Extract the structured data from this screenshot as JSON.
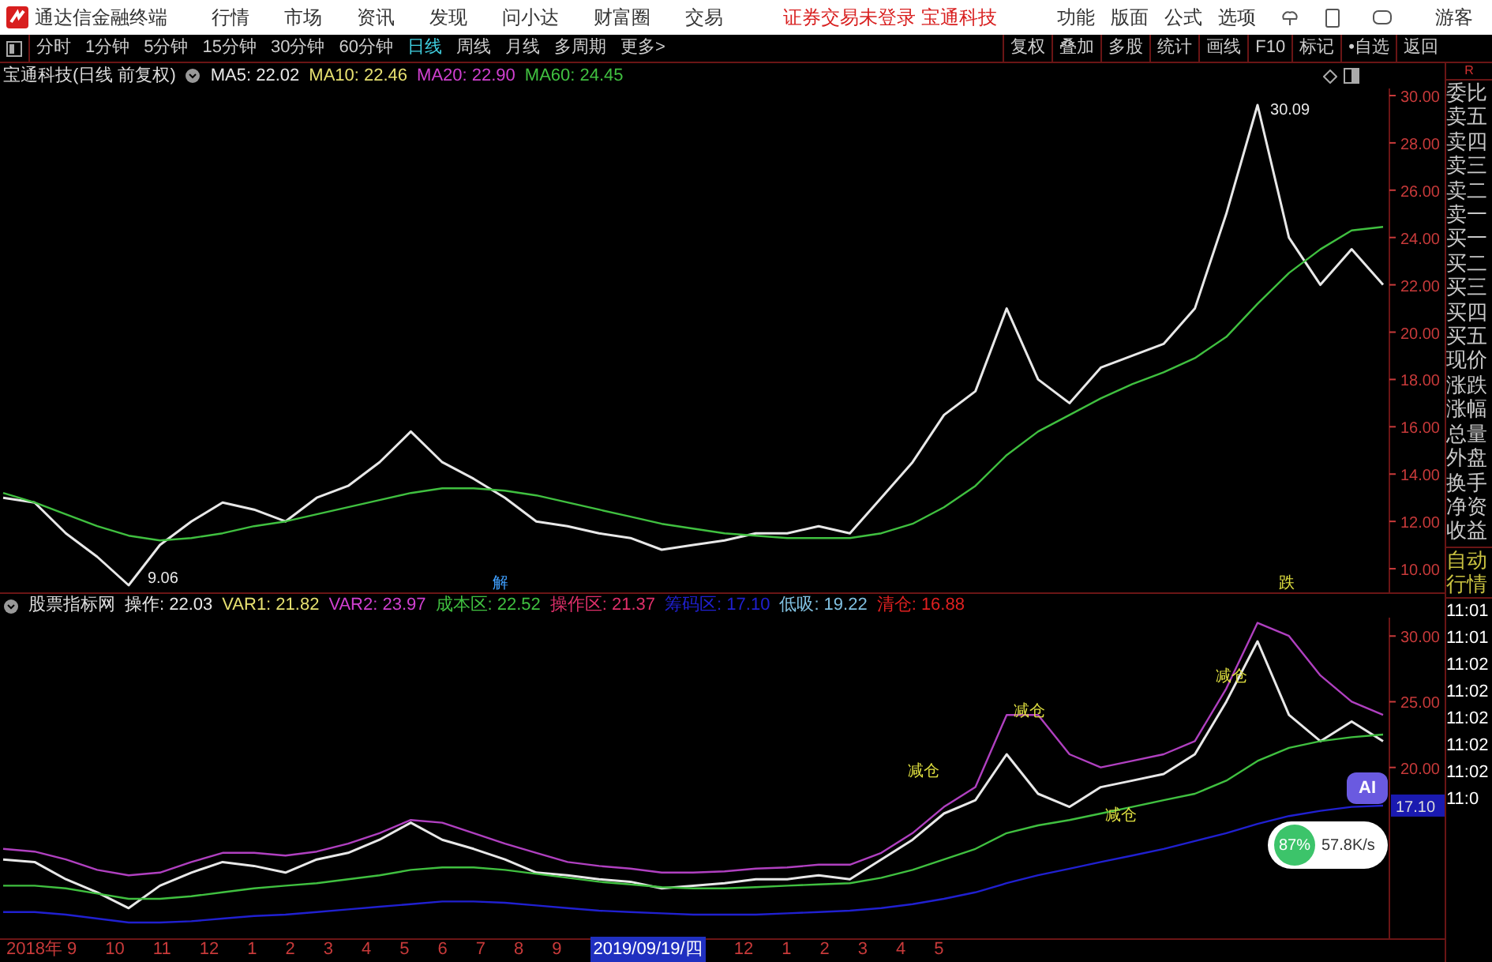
{
  "title_bar": {
    "app_name": "通达信金融终端",
    "menus": [
      "行情",
      "市场",
      "资讯",
      "发现",
      "问小达",
      "财富圈",
      "交易"
    ],
    "login_notice": "证券交易未登录 宝通科技",
    "tools": [
      "功能",
      "版面",
      "公式",
      "选项"
    ],
    "user": "游客"
  },
  "toolbar": {
    "periods": [
      {
        "label": "分时",
        "selected": false
      },
      {
        "label": "1分钟",
        "selected": false
      },
      {
        "label": "5分钟",
        "selected": false
      },
      {
        "label": "15分钟",
        "selected": false
      },
      {
        "label": "30分钟",
        "selected": false
      },
      {
        "label": "60分钟",
        "selected": false
      },
      {
        "label": "日线",
        "selected": true
      },
      {
        "label": "周线",
        "selected": false
      },
      {
        "label": "月线",
        "selected": false
      },
      {
        "label": "多周期",
        "selected": false
      },
      {
        "label": "更多>",
        "selected": false
      }
    ],
    "actions": [
      "复权",
      "叠加",
      "多股",
      "统计",
      "画线",
      "F10",
      "标记",
      "•自选",
      "返回"
    ]
  },
  "price_chart": {
    "title": "宝通科技(日线 前复权)",
    "indicators": [
      {
        "label": "MA5: 22.02",
        "color": "#e8e8e8"
      },
      {
        "label": "MA10: 22.46",
        "color": "#e6e070"
      },
      {
        "label": "MA20: 22.90",
        "color": "#d040d0"
      },
      {
        "label": "MA60: 24.45",
        "color": "#40c040"
      }
    ],
    "markers": [
      {
        "kind": "high",
        "text": "30.09",
        "color": "#e8e8e8"
      },
      {
        "kind": "low",
        "text": "9.06",
        "color": "#e8e8e8"
      },
      {
        "kind": "signal",
        "text": "解",
        "color": "#40a0ff"
      },
      {
        "kind": "signal",
        "text": "跌",
        "color": "#e0e040"
      }
    ],
    "chart_data": {
      "type": "line",
      "ylim": [
        9,
        30.3
      ],
      "yticks": [
        {
          "value": 30,
          "label": "30.00"
        },
        {
          "value": 28,
          "label": "28.00"
        },
        {
          "value": 26,
          "label": "26.00"
        },
        {
          "value": 24,
          "label": "24.00"
        },
        {
          "value": 22,
          "label": "22.00"
        },
        {
          "value": 20,
          "label": "20.00"
        },
        {
          "value": 18,
          "label": "18.00"
        },
        {
          "value": 16,
          "label": "16.00"
        },
        {
          "value": 14,
          "label": "14.00"
        },
        {
          "value": 12,
          "label": "12.00"
        },
        {
          "value": 10,
          "label": "10.00"
        }
      ],
      "series": [
        {
          "color": "#e8e8e8",
          "values": [
            13,
            12.8,
            11.5,
            10.5,
            9.3,
            11,
            12,
            12.8,
            12.5,
            12,
            13,
            13.5,
            14.5,
            15.8,
            14.5,
            13.8,
            13,
            12,
            11.8,
            11.5,
            11.3,
            10.8,
            11,
            11.2,
            11.5,
            11.5,
            11.8,
            11.5,
            13,
            14.5,
            16.5,
            17.5,
            21,
            18,
            17,
            18.5,
            19,
            19.5,
            21,
            25,
            29.6,
            24,
            22,
            23.5,
            22
          ]
        },
        {
          "color": "#40c040",
          "values": [
            13.2,
            12.8,
            12.3,
            11.8,
            11.4,
            11.2,
            11.3,
            11.5,
            11.8,
            12,
            12.3,
            12.6,
            12.9,
            13.2,
            13.4,
            13.4,
            13.3,
            13.1,
            12.8,
            12.5,
            12.2,
            11.9,
            11.7,
            11.5,
            11.4,
            11.3,
            11.3,
            11.3,
            11.5,
            11.9,
            12.6,
            13.5,
            14.8,
            15.8,
            16.5,
            17.2,
            17.8,
            18.3,
            18.9,
            19.8,
            21.2,
            22.5,
            23.5,
            24.3,
            24.45
          ]
        }
      ]
    }
  },
  "indicator_chart": {
    "title": "股票指标网",
    "indicators": [
      {
        "label": "操作: 22.03",
        "color": "#e8e8e8"
      },
      {
        "label": "VAR1: 21.82",
        "color": "#e6e070"
      },
      {
        "label": "VAR2: 23.97",
        "color": "#d040d0"
      },
      {
        "label": "成本区: 22.52",
        "color": "#40c040"
      },
      {
        "label": "操作区: 21.37",
        "color": "#e0306a"
      },
      {
        "label": "筹码区: 17.10",
        "color": "#2020d0"
      },
      {
        "label": "低吸: 19.22",
        "color": "#80c0e0"
      },
      {
        "label": "清仓: 16.88",
        "color": "#e02020"
      }
    ],
    "current_value": "17.10",
    "markers": [
      {
        "kind": "signal",
        "text": "减仓",
        "color": "#e0e040"
      },
      {
        "kind": "signal",
        "text": "减仓",
        "color": "#e0e040"
      },
      {
        "kind": "signal",
        "text": "减仓",
        "color": "#e0e040"
      },
      {
        "kind": "signal",
        "text": "减仓",
        "color": "#e0e040"
      }
    ],
    "chart_data": {
      "type": "line",
      "ylim": [
        7,
        31.4
      ],
      "yticks": [
        {
          "value": 30,
          "label": "30.00"
        },
        {
          "value": 25,
          "label": "25.00"
        },
        {
          "value": 20,
          "label": "20.00"
        }
      ],
      "series": [
        {
          "color": "#e8e8e8",
          "values": [
            13,
            12.8,
            11.5,
            10.5,
            9.3,
            11,
            12,
            12.8,
            12.5,
            12,
            13,
            13.5,
            14.5,
            15.8,
            14.5,
            13.8,
            13,
            12,
            11.8,
            11.5,
            11.3,
            10.8,
            11,
            11.2,
            11.5,
            11.5,
            11.8,
            11.5,
            13,
            14.5,
            16.5,
            17.5,
            21,
            18,
            17,
            18.5,
            19,
            19.5,
            21,
            25,
            29.6,
            24,
            22,
            23.5,
            22
          ]
        },
        {
          "color": "#b040c0",
          "values": [
            13.8,
            13.6,
            13,
            12.2,
            11.8,
            12,
            12.8,
            13.5,
            13.5,
            13.3,
            13.6,
            14.2,
            15,
            16,
            15.8,
            15,
            14.2,
            13.5,
            12.8,
            12.5,
            12.3,
            12,
            12,
            12.1,
            12.3,
            12.4,
            12.6,
            12.6,
            13.5,
            15,
            17,
            18.5,
            24,
            24,
            21,
            20,
            20.5,
            21,
            22,
            26,
            31,
            30,
            27,
            25,
            24
          ]
        },
        {
          "color": "#40c040",
          "values": [
            11,
            11,
            10.8,
            10.4,
            10,
            10,
            10.2,
            10.5,
            10.8,
            11,
            11.2,
            11.5,
            11.8,
            12.2,
            12.4,
            12.4,
            12.2,
            11.9,
            11.6,
            11.3,
            11.1,
            10.9,
            10.8,
            10.8,
            10.9,
            11,
            11.1,
            11.2,
            11.6,
            12.2,
            13,
            13.8,
            15,
            15.6,
            16,
            16.5,
            17,
            17.5,
            18,
            19,
            20.5,
            21.5,
            22,
            22.3,
            22.5
          ]
        },
        {
          "color": "#2020d0",
          "values": [
            9,
            9,
            8.8,
            8.5,
            8.2,
            8.2,
            8.3,
            8.5,
            8.7,
            8.8,
            9,
            9.2,
            9.4,
            9.6,
            9.8,
            9.8,
            9.7,
            9.5,
            9.3,
            9.1,
            9,
            8.9,
            8.8,
            8.8,
            8.8,
            8.9,
            9,
            9.1,
            9.3,
            9.6,
            10,
            10.5,
            11.2,
            11.8,
            12.3,
            12.8,
            13.3,
            13.8,
            14.4,
            15,
            15.7,
            16.3,
            16.7,
            17,
            17.1
          ]
        }
      ]
    }
  },
  "side_panel": {
    "corner_label": "R",
    "quote_labels": [
      "委比",
      "卖五",
      "卖四",
      "卖三",
      "卖二",
      "卖一",
      "买一",
      "买二",
      "买三",
      "买四",
      "买五",
      "现价",
      "涨跌",
      "涨幅",
      "总量",
      "外盘",
      "换手",
      "净资",
      "收益"
    ],
    "mode_labels": [
      "自动",
      "行情"
    ],
    "times": [
      "11:01",
      "11:01",
      "11:02",
      "11:02",
      "11:02",
      "11:02",
      "11:02",
      "11:0"
    ]
  },
  "time_axis": [
    {
      "label": "2018年 9",
      "selected": false
    },
    {
      "label": "10",
      "selected": false
    },
    {
      "label": "11",
      "selected": false
    },
    {
      "label": "12",
      "selected": false
    },
    {
      "label": "1",
      "selected": false
    },
    {
      "label": "2",
      "selected": false
    },
    {
      "label": "3",
      "selected": false
    },
    {
      "label": "4",
      "selected": false
    },
    {
      "label": "5",
      "selected": false
    },
    {
      "label": "6",
      "selected": false
    },
    {
      "label": "7",
      "selected": false
    },
    {
      "label": "8",
      "selected": false
    },
    {
      "label": "9",
      "selected": false
    },
    {
      "label": "2019/09/19/四",
      "selected": true
    },
    {
      "label": "12",
      "selected": false
    },
    {
      "label": "1",
      "selected": false
    },
    {
      "label": "2",
      "selected": false
    },
    {
      "label": "3",
      "selected": false
    },
    {
      "label": "4",
      "selected": false
    },
    {
      "label": "5",
      "selected": false
    }
  ],
  "floating": {
    "ai_label": "AI",
    "percent": "87%",
    "speed": "57.8K/s"
  }
}
